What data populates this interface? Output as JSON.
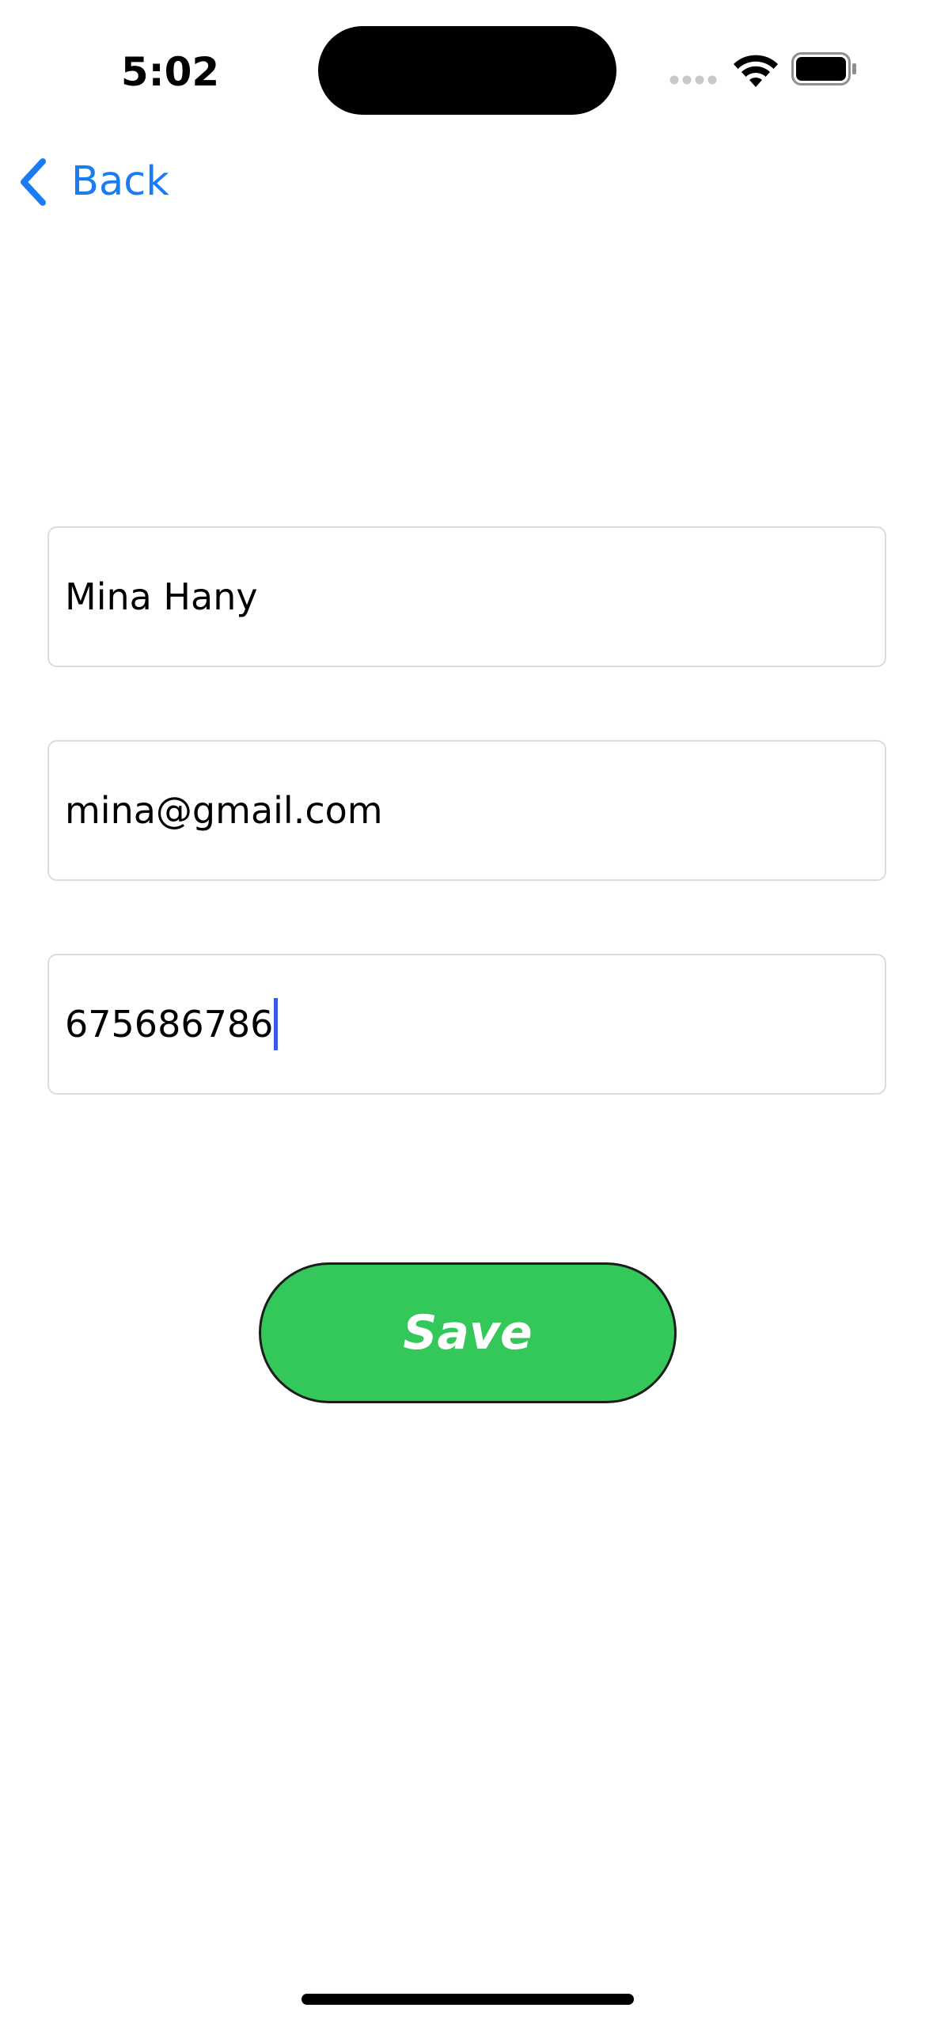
{
  "status_bar": {
    "time": "5:02",
    "icons": [
      "signal-icon",
      "wifi-icon",
      "battery-icon"
    ]
  },
  "nav": {
    "back_label": "Back",
    "back_icon": "chevron-left-icon"
  },
  "form": {
    "name_value": "Mina Hany",
    "email_value": "mina@gmail.com",
    "phone_value": "675686786"
  },
  "actions": {
    "save_label": "Save"
  },
  "colors": {
    "accent": "#1a7cf5",
    "save_button": "#34c759",
    "caret": "#3a57e8",
    "field_border": "#dcdcdc"
  }
}
